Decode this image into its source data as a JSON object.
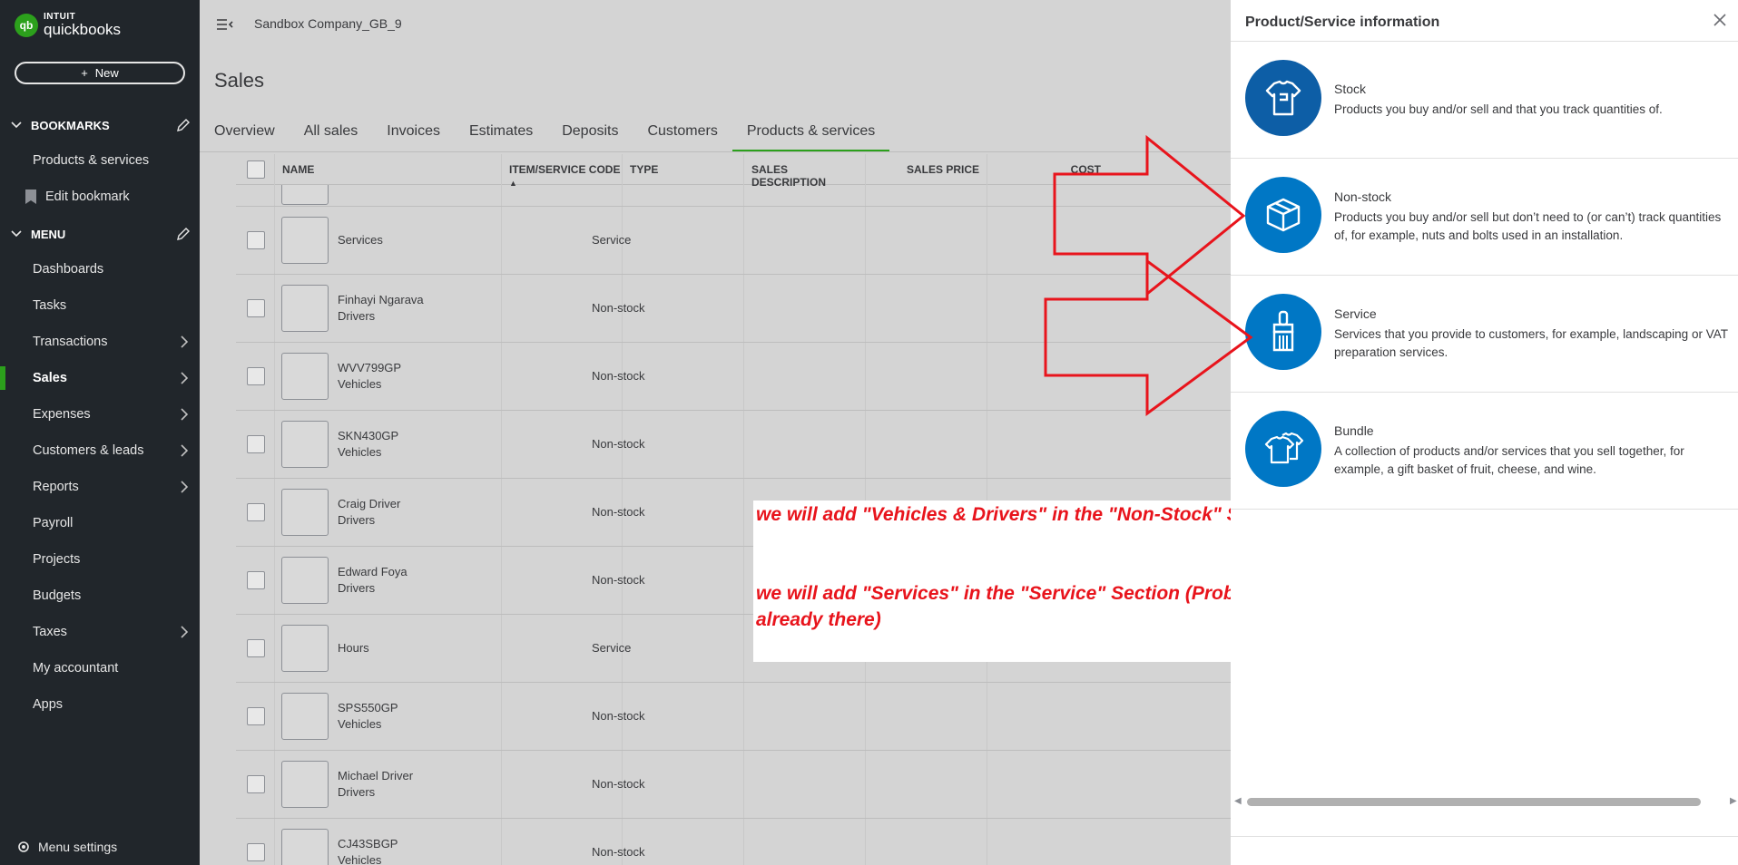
{
  "sidebar": {
    "logo_intuit": "INTUIT",
    "logo_qb": "quickbooks",
    "logo_mark": "qb",
    "new_button": "New",
    "bookmarks_label": "BOOKMARKS",
    "bookmarks": [
      {
        "label": "Products & services"
      },
      {
        "label": "Edit bookmark"
      }
    ],
    "menu_label": "MENU",
    "menu": [
      {
        "label": "Dashboards"
      },
      {
        "label": "Tasks"
      },
      {
        "label": "Transactions"
      },
      {
        "label": "Sales"
      },
      {
        "label": "Expenses"
      },
      {
        "label": "Customers & leads"
      },
      {
        "label": "Reports"
      },
      {
        "label": "Payroll"
      },
      {
        "label": "Projects"
      },
      {
        "label": "Budgets"
      },
      {
        "label": "Taxes"
      },
      {
        "label": "My accountant"
      },
      {
        "label": "Apps"
      }
    ],
    "menu_settings": "Menu settings"
  },
  "header": {
    "company": "Sandbox Company_GB_9",
    "page_title": "Sales",
    "tabs": [
      {
        "label": "Overview"
      },
      {
        "label": "All sales"
      },
      {
        "label": "Invoices"
      },
      {
        "label": "Estimates"
      },
      {
        "label": "Deposits"
      },
      {
        "label": "Customers"
      },
      {
        "label": "Products & services"
      }
    ]
  },
  "table": {
    "columns": [
      {
        "label": "NAME"
      },
      {
        "label": "ITEM/SERVICE CODE"
      },
      {
        "label": "TYPE"
      },
      {
        "label": "SALES DESCRIPTION"
      },
      {
        "label": "SALES PRICE"
      },
      {
        "label": "COST"
      }
    ],
    "sort_indicator": "▲",
    "rows": [
      {
        "name": "Services",
        "category": "",
        "type": "Service"
      },
      {
        "name": "Finhayi Ngarava",
        "category": "Drivers",
        "type": "Non-stock"
      },
      {
        "name": "WVV799GP",
        "category": "Vehicles",
        "type": "Non-stock"
      },
      {
        "name": "SKN430GP",
        "category": "Vehicles",
        "type": "Non-stock"
      },
      {
        "name": "Craig Driver",
        "category": "Drivers",
        "type": "Non-stock"
      },
      {
        "name": "Edward Foya",
        "category": "Drivers",
        "type": "Non-stock"
      },
      {
        "name": "Hours",
        "category": "",
        "type": "Service"
      },
      {
        "name": "SPS550GP",
        "category": "Vehicles",
        "type": "Non-stock"
      },
      {
        "name": "Michael Driver",
        "category": "Drivers",
        "type": "Non-stock"
      },
      {
        "name": "CJ43SBGP",
        "category": "Vehicles",
        "type": "Non-stock"
      }
    ]
  },
  "annotation": {
    "line1": "we will add \"Vehicles & Drivers\" in the \"Non-Stock\" Section",
    "line2a": "we will add \"Services\" in the \"Service\" Section (Probably",
    "line2b": "already there)",
    "color": "#e8141c"
  },
  "panel": {
    "title": "Product/Service information",
    "options": [
      {
        "title": "Stock",
        "desc": "Products you buy and/or sell and that you track quantities of.",
        "icon": "tshirt-icon"
      },
      {
        "title": "Non-stock",
        "desc": "Products you buy and/or sell but don’t need to (or can’t) track quantities of, for example, nuts and bolts used in an installation.",
        "icon": "box-icon"
      },
      {
        "title": "Service",
        "desc": "Services that you provide to customers, for example, landscaping or VAT preparation services.",
        "icon": "paintbrush-icon"
      },
      {
        "title": "Bundle",
        "desc": "A collection of products and/or services that you sell together, for example, a gift basket of fruit, cheese, and wine.",
        "icon": "bundle-icon"
      }
    ]
  },
  "colors": {
    "accent": "#2ca01c",
    "sidebar_bg": "#21262b",
    "icon_blue": "#0077c5"
  }
}
